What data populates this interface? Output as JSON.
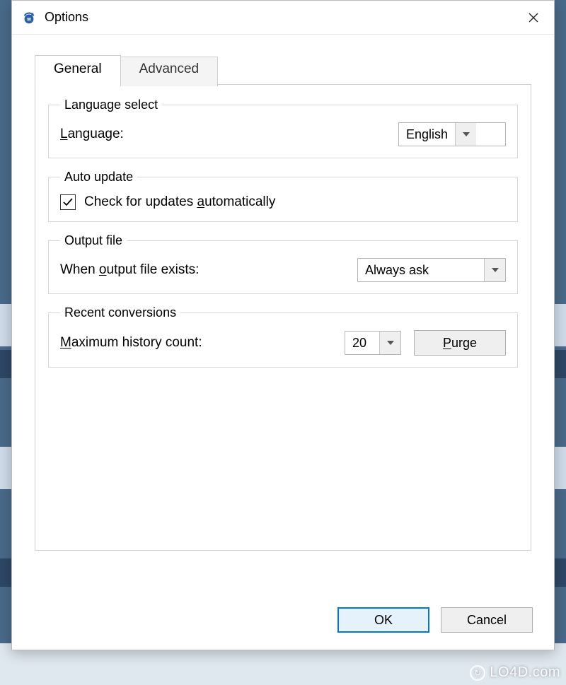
{
  "window": {
    "title": "Options"
  },
  "tabs": {
    "general": "General",
    "advanced": "Advanced"
  },
  "groups": {
    "language_select": {
      "legend": "Language select",
      "label_pre": "L",
      "label_post": "anguage:",
      "value": "English"
    },
    "auto_update": {
      "legend": "Auto update",
      "checkbox_pre": "Check for updates ",
      "checkbox_u": "a",
      "checkbox_post": "utomatically",
      "checked": true
    },
    "output_file": {
      "legend": "Output file",
      "label_pre": "When ",
      "label_u": "o",
      "label_post": "utput file exists:",
      "value": "Always ask"
    },
    "recent": {
      "legend": "Recent conversions",
      "label_u": "M",
      "label_post": "aximum history count:",
      "value": "20",
      "purge_u": "P",
      "purge_post": "urge"
    }
  },
  "buttons": {
    "ok": "OK",
    "cancel": "Cancel"
  },
  "watermark": "LO4D.com"
}
